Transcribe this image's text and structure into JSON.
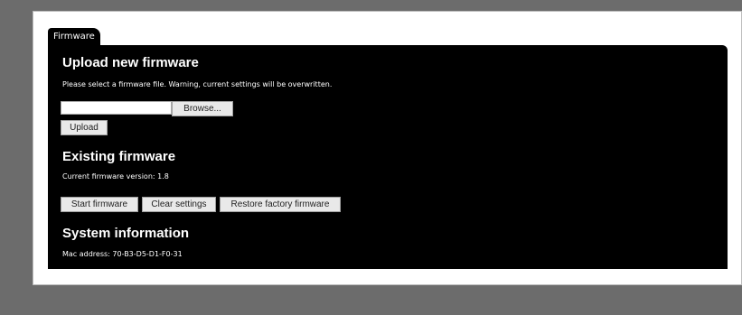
{
  "tab": {
    "label": "Firmware"
  },
  "upload": {
    "title": "Upload new firmware",
    "description": "Please select a firmware file. Warning, current settings will be overwritten.",
    "file_value": "",
    "browse_label": "Browse...",
    "upload_label": "Upload"
  },
  "existing": {
    "title": "Existing firmware",
    "version_text": "Current firmware version: 1.8",
    "start_label": "Start firmware",
    "clear_label": "Clear settings",
    "restore_label": "Restore factory firmware"
  },
  "system": {
    "title": "System information",
    "mac_text": "Mac address: 70-B3-D5-D1-F0-31"
  }
}
